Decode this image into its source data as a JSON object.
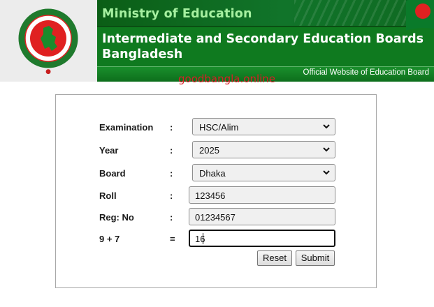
{
  "header": {
    "ministry": "Ministry of Education",
    "boards_title": "Intermediate and Secondary Education Boards Bangladesh",
    "official_site": "Official Website of Education Board",
    "logo_icon": "government-seal-icon",
    "flag_icon": "bangladesh-flag-icon"
  },
  "watermark": "goodbangla.online",
  "form": {
    "examination": {
      "label": "Examination",
      "sep": ":",
      "value": "HSC/Alim"
    },
    "year": {
      "label": "Year",
      "sep": ":",
      "value": "2025"
    },
    "board": {
      "label": "Board",
      "sep": ":",
      "value": "Dhaka"
    },
    "roll": {
      "label": "Roll",
      "sep": ":",
      "value": "123456"
    },
    "reg": {
      "label": "Reg: No",
      "sep": ":",
      "value": "01234567"
    },
    "captcha": {
      "label": "9 + 7",
      "sep": "=",
      "value": "16"
    },
    "reset_label": "Reset",
    "submit_label": "Submit"
  },
  "colors": {
    "banner_green": "#0f7a1f",
    "ministry_text": "#a6f0a0",
    "watermark_red": "#d81f26",
    "seal_red": "#e02121"
  }
}
